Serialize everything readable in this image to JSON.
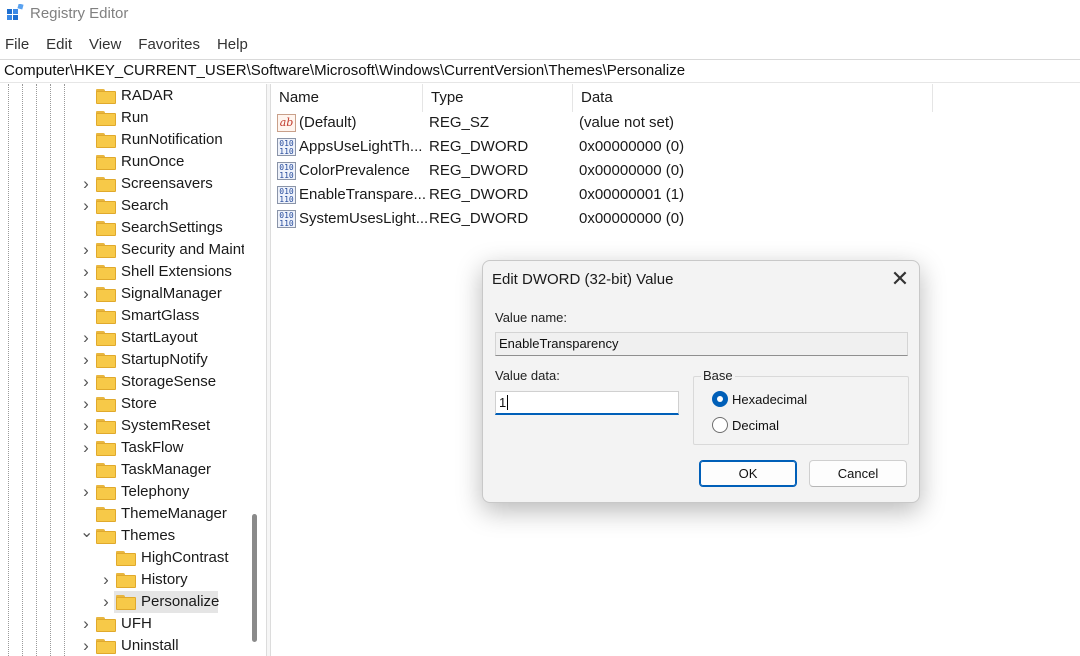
{
  "window": {
    "title": "Registry Editor"
  },
  "menu": [
    "File",
    "Edit",
    "View",
    "Favorites",
    "Help"
  ],
  "address": "Computer\\HKEY_CURRENT_USER\\Software\\Microsoft\\Windows\\CurrentVersion\\Themes\\Personalize",
  "tree": {
    "items": [
      {
        "label": "RADAR",
        "expandable": false
      },
      {
        "label": "Run",
        "expandable": false
      },
      {
        "label": "RunNotification",
        "expandable": false
      },
      {
        "label": "RunOnce",
        "expandable": false
      },
      {
        "label": "Screensavers",
        "expandable": true
      },
      {
        "label": "Search",
        "expandable": true
      },
      {
        "label": "SearchSettings",
        "expandable": false
      },
      {
        "label": "Security and Maint",
        "expandable": true
      },
      {
        "label": "Shell Extensions",
        "expandable": true
      },
      {
        "label": "SignalManager",
        "expandable": true
      },
      {
        "label": "SmartGlass",
        "expandable": false
      },
      {
        "label": "StartLayout",
        "expandable": true
      },
      {
        "label": "StartupNotify",
        "expandable": true
      },
      {
        "label": "StorageSense",
        "expandable": true
      },
      {
        "label": "Store",
        "expandable": true
      },
      {
        "label": "SystemReset",
        "expandable": true
      },
      {
        "label": "TaskFlow",
        "expandable": true
      },
      {
        "label": "TaskManager",
        "expandable": false
      },
      {
        "label": "Telephony",
        "expandable": true
      },
      {
        "label": "ThemeManager",
        "expandable": false
      },
      {
        "label": "Themes",
        "expandable": true,
        "expanded": true
      },
      {
        "label": "HighContrast",
        "expandable": false,
        "child": true
      },
      {
        "label": "History",
        "expandable": true,
        "child": true
      },
      {
        "label": "Personalize",
        "expandable": true,
        "child": true,
        "selected": true
      },
      {
        "label": "UFH",
        "expandable": true
      },
      {
        "label": "Uninstall",
        "expandable": true
      }
    ]
  },
  "list": {
    "columns": [
      "Name",
      "Type",
      "Data"
    ],
    "rows": [
      {
        "icon": "string-value-icon",
        "name": "(Default)",
        "type": "REG_SZ",
        "data": "(value not set)"
      },
      {
        "icon": "binary-value-icon",
        "name": "AppsUseLightTh...",
        "type": "REG_DWORD",
        "data": "0x00000000 (0)"
      },
      {
        "icon": "binary-value-icon",
        "name": "ColorPrevalence",
        "type": "REG_DWORD",
        "data": "0x00000000 (0)"
      },
      {
        "icon": "binary-value-icon",
        "name": "EnableTranspare...",
        "type": "REG_DWORD",
        "data": "0x00000001 (1)"
      },
      {
        "icon": "binary-value-icon",
        "name": "SystemUsesLight...",
        "type": "REG_DWORD",
        "data": "0x00000000 (0)"
      }
    ]
  },
  "dialog": {
    "title": "Edit DWORD (32-bit) Value",
    "close_glyph": "✕",
    "value_name_label": "Value name:",
    "value_name": "EnableTransparency",
    "value_data_label": "Value data:",
    "value_data": "1",
    "base_label": "Base",
    "hex_label": "Hexadecimal",
    "dec_label": "Decimal",
    "selected_base": "Hexadecimal",
    "ok_label": "OK",
    "cancel_label": "Cancel"
  },
  "colors": {
    "accent": "#005fb8",
    "folder": "#f7c948",
    "selection": "#e5e5e5"
  }
}
